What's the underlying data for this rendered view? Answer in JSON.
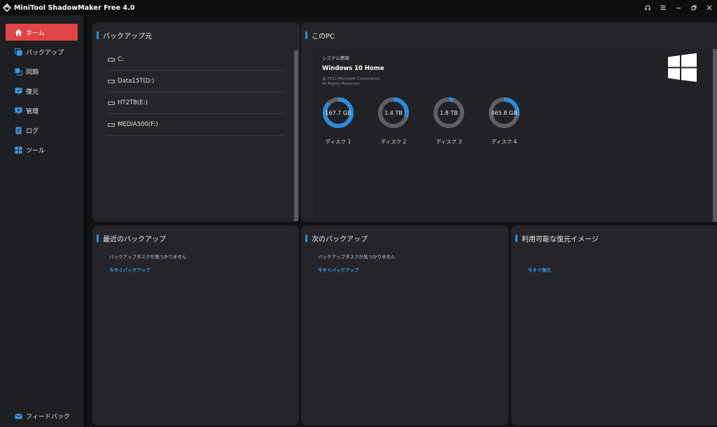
{
  "app": {
    "title": "MiniTool ShadowMaker Free 4.0"
  },
  "window_controls": [
    "headset-icon",
    "menu-icon",
    "minimize-icon",
    "restore-icon",
    "close-icon"
  ],
  "sidebar": {
    "items": [
      {
        "label": "ホーム",
        "icon": "home-icon",
        "active": true
      },
      {
        "label": "バックアップ",
        "icon": "backup-icon",
        "active": false
      },
      {
        "label": "同期",
        "icon": "sync-icon",
        "active": false
      },
      {
        "label": "復元",
        "icon": "restore-data-icon",
        "active": false
      },
      {
        "label": "管理",
        "icon": "manage-icon",
        "active": false
      },
      {
        "label": "ログ",
        "icon": "log-icon",
        "active": false
      },
      {
        "label": "ツール",
        "icon": "tools-icon",
        "active": false
      }
    ],
    "feedback_label": "フィードバック"
  },
  "backup_source": {
    "title": "バックアップ元",
    "drives": [
      "C:",
      "Data15T(D:)",
      "HT2TB(E:)",
      "MEDIA500(F:)"
    ]
  },
  "this_pc": {
    "title": "このPC",
    "system_info_label": "システム情報",
    "os_name": "Windows 10 Home",
    "copyright_line1": "@ 2022 Microsoft Corporation.",
    "copyright_line2": "All Rights Reserved.",
    "disks": [
      {
        "size": "167.7 GB",
        "label": "ディスク 1",
        "used_fraction": 0.88
      },
      {
        "size": "1.4 TB",
        "label": "ディスク 2",
        "used_fraction": 0.3
      },
      {
        "size": "1.8 TB",
        "label": "ディスク 3",
        "used_fraction": 0.06
      },
      {
        "size": "465.8 GB",
        "label": "ディスク 4",
        "used_fraction": 0.28
      }
    ]
  },
  "recent_backup": {
    "title": "最近のバックアップ",
    "message": "バックアップタスクが見つかりません",
    "link": "今すぐバックアップ"
  },
  "next_backup": {
    "title": "次のバックアップ",
    "message": "バックアップタスクが見つかりません",
    "link": "今すぐバックアップ"
  },
  "restore_images": {
    "title": "利用可能な復元イメージ",
    "link": "今すぐ復元"
  },
  "colors": {
    "accent": "#2a8de0",
    "active_nav": "#e04545",
    "ring_track": "#5f6063",
    "ring_fill": "#2a8de0"
  }
}
